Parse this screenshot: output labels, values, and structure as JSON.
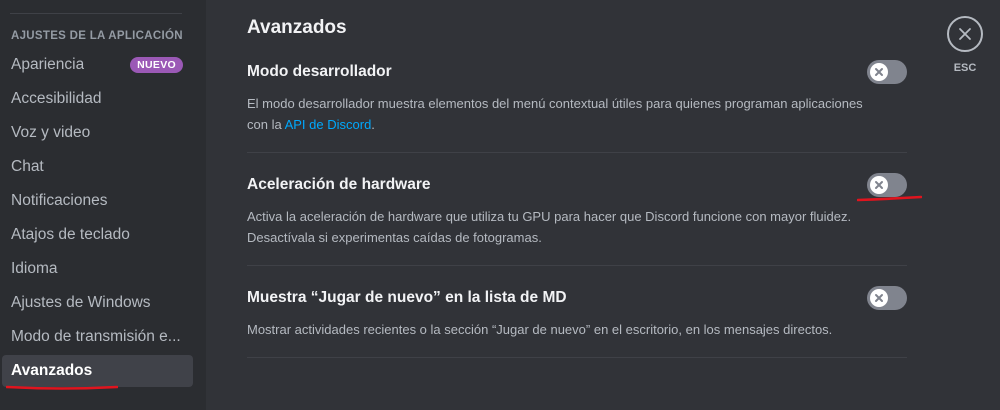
{
  "sidebar": {
    "header": "Ajustes de la aplicación",
    "items": [
      {
        "label": "Apariencia",
        "badge": "NUEVO"
      },
      {
        "label": "Accesibilidad"
      },
      {
        "label": "Voz y video"
      },
      {
        "label": "Chat"
      },
      {
        "label": "Notificaciones"
      },
      {
        "label": "Atajos de teclado"
      },
      {
        "label": "Idioma"
      },
      {
        "label": "Ajustes de Windows"
      },
      {
        "label": "Modo de transmisión e..."
      },
      {
        "label": "Avanzados",
        "selected": true
      }
    ]
  },
  "main": {
    "title": "Avanzados",
    "settings": [
      {
        "title": "Modo desarrollador",
        "desc_before": "El modo desarrollador muestra elementos del menú contextual útiles para quienes programan aplicaciones con la ",
        "desc_link": "API de Discord",
        "desc_after": ".",
        "enabled": false
      },
      {
        "title": "Aceleración de hardware",
        "desc": "Activa la aceleración de hardware que utiliza tu GPU para hacer que Discord funcione con mayor fluidez. Desactívala si experimentas caídas de fotogramas.",
        "enabled": false
      },
      {
        "title": "Muestra “Jugar de nuevo” en la lista de MD",
        "desc": "Mostrar actividades recientes o la sección “Jugar de nuevo” en el escritorio, en los mensajes directos.",
        "enabled": false
      }
    ]
  },
  "esc": {
    "label": "ESC"
  },
  "icons": {
    "toggle_off": "x-icon",
    "close": "close-icon"
  },
  "colors": {
    "background": "#313338",
    "sidebar": "#2b2d31",
    "selected_item": "#404249",
    "badge": "#9b59b6",
    "link": "#00a8fc",
    "toggle_off": "#80848e",
    "annotation": "#e0141e"
  }
}
